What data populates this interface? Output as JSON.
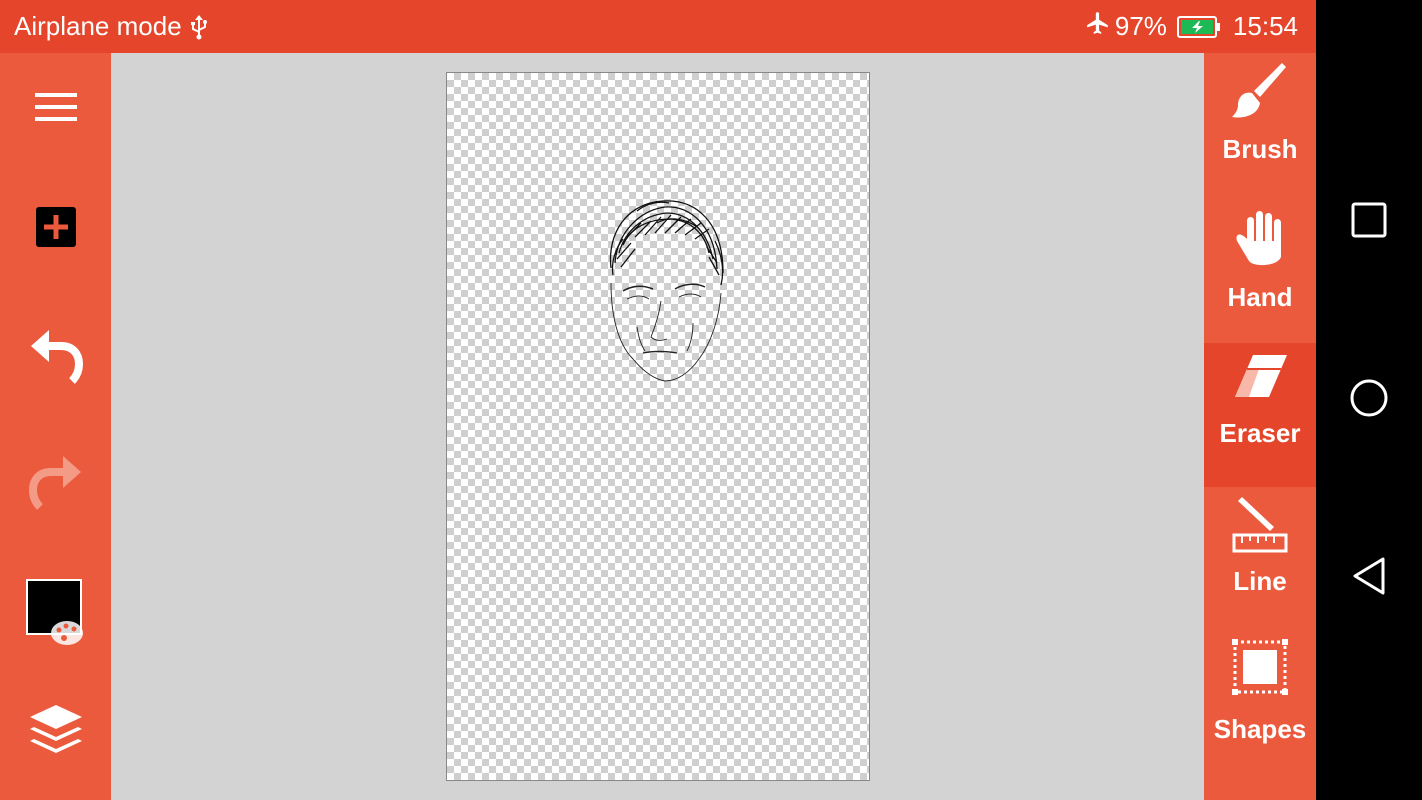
{
  "status_bar": {
    "mode_text": "Airplane mode",
    "battery_percent": "97%",
    "time": "15:54",
    "colors": {
      "background": "#E5452A",
      "battery_fill": "#1DB954"
    }
  },
  "left_toolbar": {
    "items": [
      {
        "icon": "hamburger-menu-icon"
      },
      {
        "icon": "add-layer-icon"
      },
      {
        "icon": "undo-icon"
      },
      {
        "icon": "redo-icon",
        "enabled": false
      },
      {
        "icon": "color-picker-icon",
        "current_color": "#000000"
      },
      {
        "icon": "layers-icon"
      }
    ]
  },
  "right_toolbar": {
    "tools": [
      {
        "label": "Brush",
        "icon": "brush-icon"
      },
      {
        "label": "Hand",
        "icon": "hand-icon"
      },
      {
        "label": "Eraser",
        "icon": "eraser-icon",
        "active": true
      },
      {
        "label": "Line",
        "icon": "line-ruler-icon"
      },
      {
        "label": "Shapes",
        "icon": "shapes-icon"
      }
    ]
  },
  "nav_bar": {
    "buttons": [
      {
        "icon": "recents-square-icon"
      },
      {
        "icon": "home-circle-icon"
      },
      {
        "icon": "back-triangle-icon"
      }
    ]
  },
  "colors": {
    "toolbar": "#EC5A3E",
    "active_tool": "#E5452A",
    "canvas_area": "#D3D3D3"
  }
}
